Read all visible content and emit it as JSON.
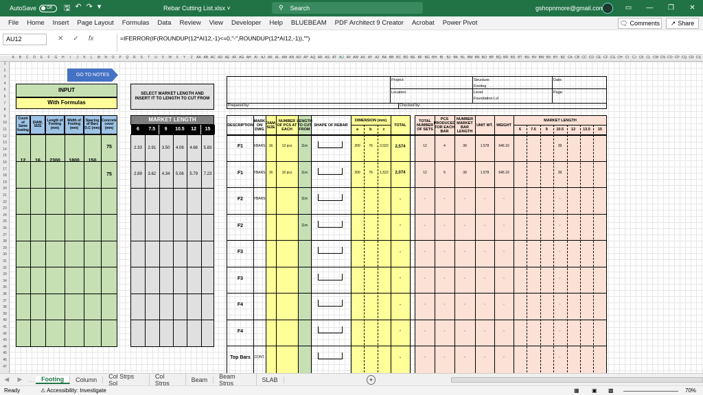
{
  "titlebar": {
    "autosave": "AutoSave",
    "toggle": "Off",
    "filename": "Rebar Cutting List.xlsx",
    "search_placeholder": "Search",
    "user": "gshopnmore@gmail.com",
    "avatar_initials": "GM"
  },
  "menu": [
    "File",
    "Home",
    "Insert",
    "Page Layout",
    "Formulas",
    "Data",
    "Review",
    "View",
    "Developer",
    "Help",
    "BLUEBEAM",
    "PDF Architect 9 Creator",
    "Acrobat",
    "Power Pivot"
  ],
  "ribbon_buttons": {
    "comments": "Comments",
    "share": "Share"
  },
  "formula_bar": {
    "namebox": "AU12",
    "formula": "=IFERROR(IF(ROUNDUP(12*AI12,-1)<=0,\"-\",ROUNDUP(12*AI12,-1)),\"\")"
  },
  "columns": [
    "A",
    "B",
    "C",
    "D",
    "E",
    "F",
    "G",
    "H",
    "I",
    "J",
    "K",
    "L",
    "M",
    "N",
    "O",
    "P",
    "Q",
    "R",
    "S",
    "T",
    "U",
    "V",
    "W",
    "X",
    "Y",
    "Z",
    "AA",
    "AB",
    "AC",
    "AD",
    "AE",
    "AF",
    "AG",
    "AH",
    "AI",
    "AJ",
    "AK",
    "AL",
    "AM",
    "AN",
    "AO",
    "AP",
    "AQ",
    "AR",
    "AS",
    "AT",
    "AU",
    "AV",
    "AW",
    "AX",
    "AY",
    "AZ",
    "BA",
    "BB",
    "BC",
    "BD",
    "BE",
    "BF",
    "BG",
    "BH",
    "BI",
    "BJ",
    "BK",
    "BL",
    "BM",
    "BN",
    "BO",
    "BP",
    "BQ",
    "BR",
    "BS",
    "BT",
    "BU",
    "BV",
    "BW",
    "BX",
    "BY",
    "BZ",
    "CA",
    "CB",
    "CC",
    "CD",
    "CE",
    "CF",
    "CG",
    "CH",
    "CI",
    "CJ",
    "CK",
    "CL",
    "CM",
    "CN",
    "CO",
    "CP",
    "CQ",
    "CR",
    "CS"
  ],
  "rows": [
    "1",
    "2",
    "3",
    "4",
    "5",
    "6",
    "7",
    "8",
    "9",
    "10",
    "11",
    "12",
    "13",
    "14",
    "15",
    "16",
    "17",
    "18",
    "19",
    "20",
    "21",
    "22",
    "23",
    "24",
    "25",
    "26",
    "27",
    "28",
    "29",
    "30",
    "31",
    "32",
    "33",
    "34",
    "35",
    "36",
    "37",
    "38",
    "39",
    "40",
    "41",
    "42",
    "43",
    "44",
    "45",
    "46",
    "47"
  ],
  "notes_button": "GO TO NOTES",
  "input": {
    "title": "INPUT",
    "subtitle": "With Formulas",
    "headers": [
      "Count of Same footing",
      "DIAM. SIZE",
      "Length of Footing (mm)",
      "Width of Footing (mm)",
      "Spacing of Bars O.C (mm)",
      "Concrete cover (mm)"
    ],
    "values": [
      "12",
      "16",
      "2300",
      "1800",
      "150"
    ],
    "cover": [
      "75",
      "75"
    ]
  },
  "market": {
    "instruction": "SELECT MARKET LENGTH AND INSERT IT TO LENGTH TO CUT FROM",
    "title": "MARKET LENGTH",
    "lengths": [
      "6",
      "7.5",
      "9",
      "10.5",
      "12",
      "15"
    ],
    "row1": [
      "2.33",
      "2.91",
      "3.50",
      "4.08",
      "4.66",
      "5.83"
    ],
    "row2": [
      "2.89",
      "3.62",
      "4.34",
      "5.06",
      "5.79",
      "7.23"
    ]
  },
  "project": {
    "project": "Project:",
    "location": "Location:",
    "structure": "Structure:",
    "structure_val": "Footing",
    "level": "Level:",
    "level_val": "Foundation Lvl",
    "date": "Date:",
    "page": "Page:",
    "prepared": "Prepared by:",
    "checked": "Checked by:"
  },
  "table": {
    "headers": {
      "desc": "DESCRIPTION",
      "mark": "MARK ON DWG",
      "diam": "DIAM. SIZE",
      "num": "NUMBER OF PCS AT EACH",
      "length": "LENGTH TO CUT FROM",
      "shape": "SHAPE OF REBAR",
      "dimension": "DIMENSION (mm)",
      "a": "a",
      "b": "b",
      "c": "c",
      "total": "TOTAL",
      "sets": "TOTAL NUMBER OF SETS",
      "pcs": "PCS PRODUCED FOR EACH BAR",
      "nml": "NUMBER MARKET BAR LENGTH",
      "unitwt": "UNIT WT.",
      "weight": "WEIGHT",
      "mlen": "MARKET LENGTH"
    },
    "mlens": [
      "6",
      "7.5",
      "9",
      "10.5",
      "12",
      "13.5",
      "15"
    ],
    "rows": [
      {
        "desc": "F1",
        "mark": "XBARS",
        "diam": "16",
        "num": "13 pcs",
        "len": "11m",
        "a": "200",
        "b": "76",
        "c": "2,022",
        "total": "2,574",
        "sets": "12",
        "pcs": "4",
        "nml": "39",
        "uw": "1.578",
        "wt": "646.19",
        "m105": "39"
      },
      {
        "desc": "F1",
        "mark": "YBARS",
        "diam": "16",
        "num": "16 pcs",
        "len": "11m",
        "a": "200",
        "b": "76",
        "c": "1,522",
        "total": "2,074",
        "sets": "12",
        "pcs": "5",
        "nml": "39",
        "uw": "1.578",
        "wt": "646.19",
        "m105": "39"
      },
      {
        "desc": "F2",
        "mark": "YBARS",
        "diam": "",
        "num": "",
        "len": "11m",
        "a": "",
        "b": "",
        "c": "",
        "total": "-",
        "sets": "-",
        "pcs": "-",
        "nml": "-",
        "uw": "-",
        "wt": "-",
        "m105": "-"
      },
      {
        "desc": "F2",
        "mark": "",
        "diam": "",
        "num": "",
        "len": "11m",
        "a": "",
        "b": "",
        "c": "",
        "total": "-",
        "sets": "-",
        "pcs": "-",
        "nml": "-",
        "uw": "-",
        "wt": "-",
        "m105": "-"
      },
      {
        "desc": "F3",
        "mark": "",
        "diam": "",
        "num": "",
        "len": "",
        "a": "",
        "b": "",
        "c": "",
        "total": "-",
        "sets": "-",
        "pcs": "-",
        "nml": "-",
        "uw": "-",
        "wt": "-",
        "m105": "-"
      },
      {
        "desc": "F3",
        "mark": "",
        "diam": "",
        "num": "",
        "len": "",
        "a": "",
        "b": "",
        "c": "",
        "total": "-",
        "sets": "-",
        "pcs": "-",
        "nml": "-",
        "uw": "-",
        "wt": "-",
        "m105": "-"
      },
      {
        "desc": "F4",
        "mark": "",
        "diam": "",
        "num": "",
        "len": "",
        "a": "",
        "b": "",
        "c": "",
        "total": "-",
        "sets": "-",
        "pcs": "-",
        "nml": "-",
        "uw": "-",
        "wt": "-",
        "m105": "-"
      },
      {
        "desc": "F4",
        "mark": "",
        "diam": "",
        "num": "",
        "len": "",
        "a": "",
        "b": "",
        "c": "",
        "total": "-",
        "sets": "-",
        "pcs": "-",
        "nml": "-",
        "uw": "-",
        "wt": "-",
        "m105": "-"
      },
      {
        "desc": "Top Bars",
        "mark": "CONT.",
        "diam": "",
        "num": "",
        "len": "",
        "a": "",
        "b": "",
        "c": "",
        "total": "-",
        "sets": "-",
        "pcs": "-",
        "nml": "-",
        "uw": "-",
        "wt": "-",
        "m105": "-"
      }
    ]
  },
  "tabs": [
    "Footing",
    "Column",
    "Col Strps Sol",
    "Col Strps",
    "Beam",
    "Beam Strps",
    "SLAB"
  ],
  "status": {
    "ready": "Ready",
    "accessibility": "Accessibility: Investigate",
    "zoom": "70%"
  }
}
